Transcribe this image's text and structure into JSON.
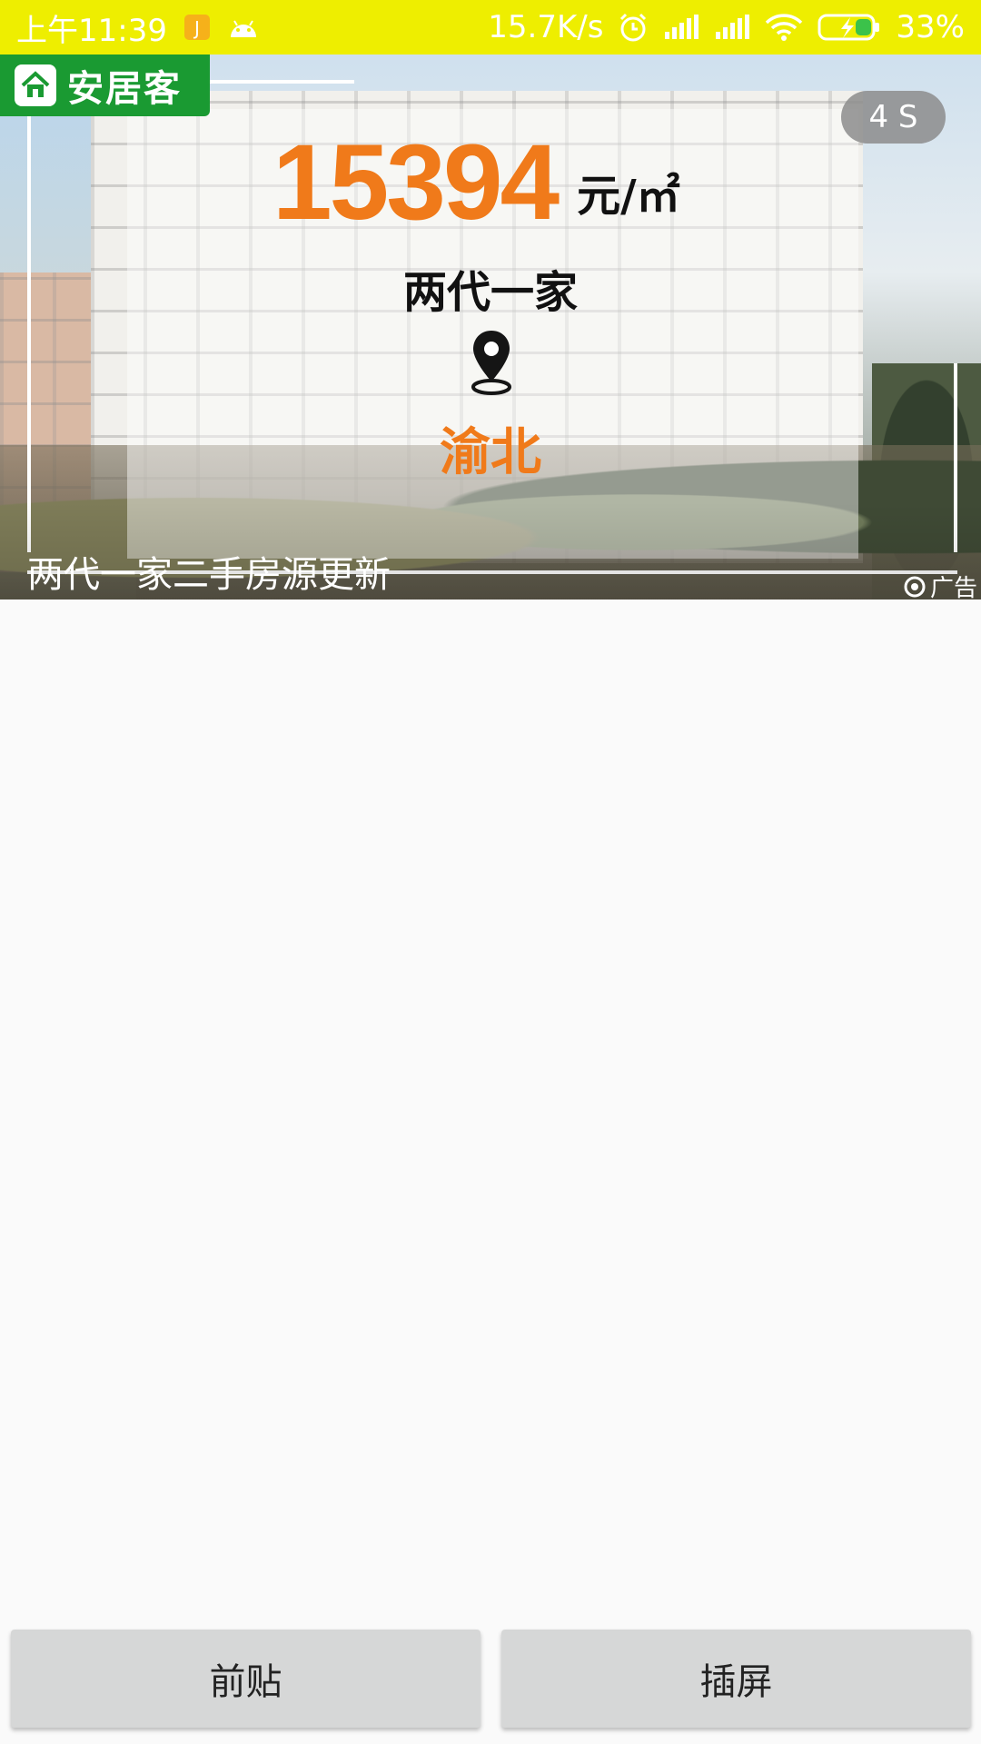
{
  "status_bar": {
    "time": "上午11:39",
    "network_speed": "15.7K/s",
    "battery": "33%",
    "background": "#eeee00",
    "icons": [
      "notification-app-icon",
      "android-icon",
      "alarm-icon",
      "signal-icon",
      "signal-icon",
      "wifi-icon",
      "battery-charging-icon"
    ]
  },
  "ad": {
    "brand": "安居客",
    "countdown": "4 S",
    "price": "15394",
    "price_unit": "元/㎡",
    "community": "两代一家",
    "district": "渝北",
    "caption": "两代一家二手房源更新",
    "ad_tag": "广告",
    "accent_color": "#f07a1a",
    "brand_color": "#1a9a32"
  },
  "buttons": {
    "preroll": "前贴",
    "interstitial": "插屏"
  }
}
